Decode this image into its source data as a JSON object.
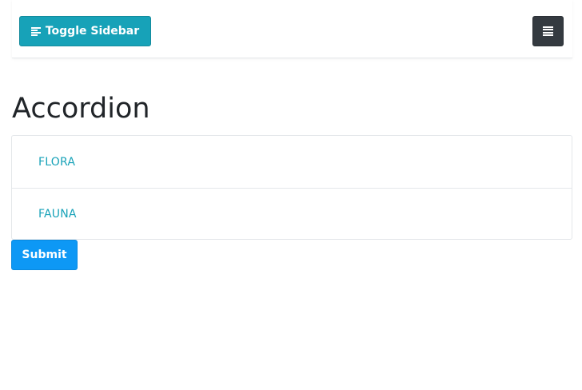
{
  "navbar": {
    "toggle_label": "Toggle Sidebar",
    "toggle_icon": "align-left-icon",
    "menu_icon": "bars-icon"
  },
  "page": {
    "title": "Accordion"
  },
  "accordion": {
    "items": [
      {
        "label": "FLORA"
      },
      {
        "label": "FAUNA"
      }
    ]
  },
  "form": {
    "submit_label": "Submit"
  },
  "colors": {
    "toggle_button": "#17a2b8",
    "menu_button": "#343a40",
    "accordion_text": "#17a2b8",
    "submit_button": "#0d98f5"
  }
}
